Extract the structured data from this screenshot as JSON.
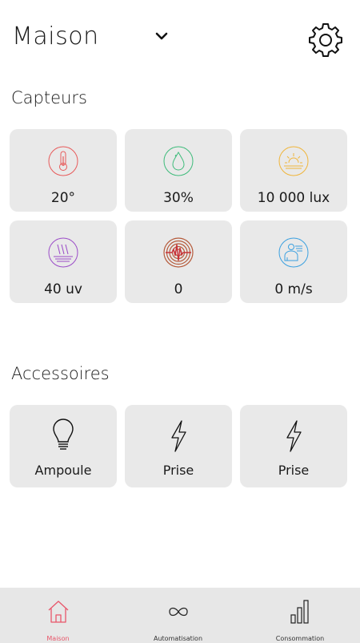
{
  "header": {
    "title": "Maison"
  },
  "sections": {
    "sensors_title": "Capteurs",
    "accessories_title": "Accessoires"
  },
  "sensors": [
    {
      "icon": "thermometer-icon",
      "value": "20°",
      "color": "#e85a5a"
    },
    {
      "icon": "droplet-icon",
      "value": "30%",
      "color": "#3dbb7a"
    },
    {
      "icon": "sun-lux-icon",
      "value": "10 000 lux",
      "color": "#f0b53a"
    },
    {
      "icon": "uv-icon",
      "value": "40 uv",
      "color": "#9b4cc8"
    },
    {
      "icon": "seismic-icon",
      "value": "0",
      "color": "#b55a3a"
    },
    {
      "icon": "wind-person-icon",
      "value": "0 m/s",
      "color": "#3aa0e0"
    }
  ],
  "accessories": [
    {
      "icon": "lightbulb-icon",
      "label": "Ampoule"
    },
    {
      "icon": "lightning-icon",
      "label": "Prise"
    },
    {
      "icon": "lightning-icon",
      "label": "Prise"
    }
  ],
  "tabs": [
    {
      "icon": "home-icon",
      "label": "Maison",
      "active": true,
      "color": "#e8566a"
    },
    {
      "icon": "infinity-icon",
      "label": "Automatisation",
      "active": false
    },
    {
      "icon": "bar-chart-icon",
      "label": "Consommation",
      "active": false
    }
  ]
}
